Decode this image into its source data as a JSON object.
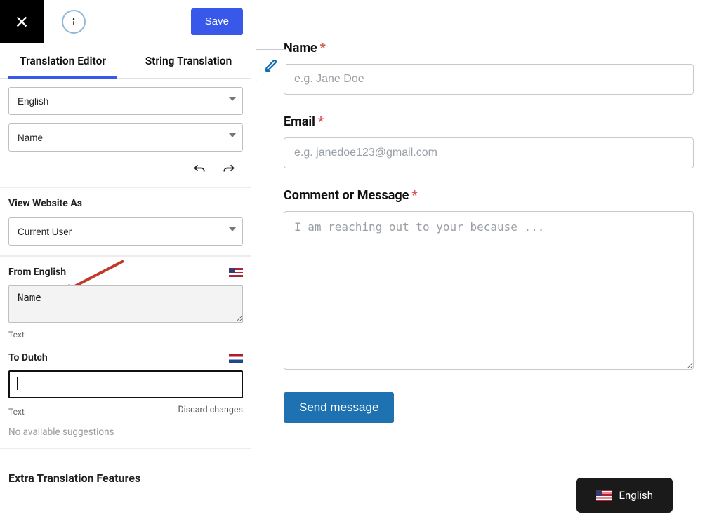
{
  "header": {
    "save_label": "Save"
  },
  "tabs": {
    "tab1": "Translation Editor",
    "tab2": "String Translation"
  },
  "selectors": {
    "language": "English",
    "field": "Name"
  },
  "view_as": {
    "label": "View Website As",
    "value": "Current User"
  },
  "source": {
    "label": "From English",
    "value": "Name",
    "type_label": "Text"
  },
  "target": {
    "label": "To Dutch",
    "value": "",
    "type_label": "Text",
    "discard_label": "Discard changes"
  },
  "suggestions": {
    "none_label": "No available suggestions"
  },
  "extra": {
    "title": "Extra Translation Features"
  },
  "form": {
    "name_label": "Name",
    "name_placeholder": "e.g. Jane Doe",
    "email_label": "Email",
    "email_placeholder": "e.g. janedoe123@gmail.com",
    "message_label": "Comment or Message",
    "message_placeholder": "I am reaching out to your because ...",
    "submit_label": "Send message"
  },
  "lang_switcher": {
    "current": "English"
  }
}
